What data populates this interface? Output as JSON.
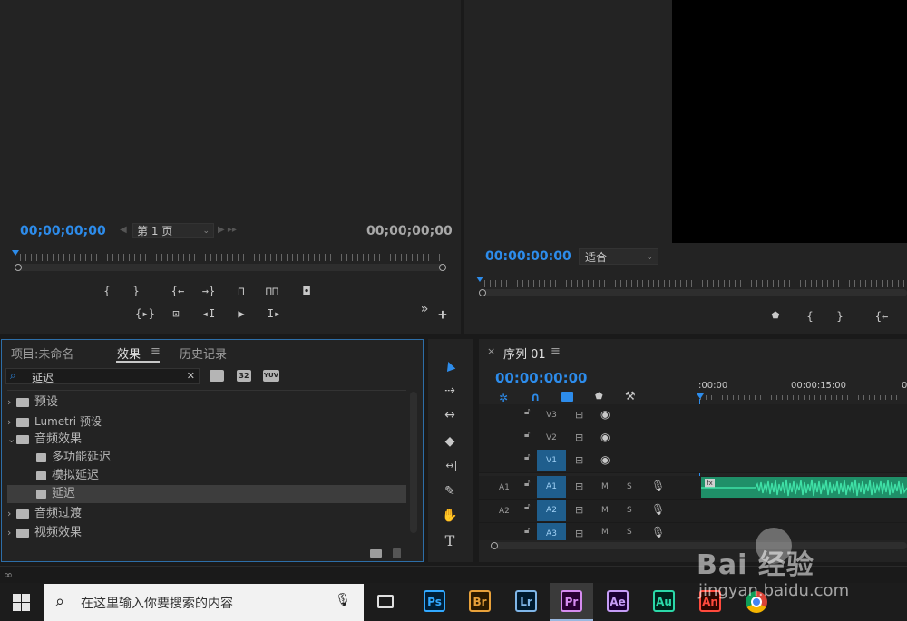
{
  "source_monitor": {
    "timecode_left": "00;00;00;00",
    "page_label": "第 1 页",
    "timecode_right": "00;00;00;00",
    "controls_row1": [
      "{",
      "}",
      "{←",
      "→}",
      "⊓",
      "⊓⊓",
      "◘"
    ],
    "controls_row2": [
      "{▸}",
      "⊡",
      "◂I",
      "▶",
      "I▸"
    ],
    "more": "»",
    "add": "+"
  },
  "program_monitor": {
    "timecode": "00:00:00:00",
    "zoom_value": "适合",
    "controls": [
      "⬟",
      "{",
      "}",
      "{←"
    ]
  },
  "effects_panel": {
    "tabs": [
      "项目:未命名",
      "效果",
      "历史记录"
    ],
    "tab_menu": "≡",
    "search_value": "延迟",
    "clear_icon": "✕",
    "filter_badges": [
      "32",
      "YUV"
    ],
    "tree": [
      {
        "label": "预设",
        "type": "folder",
        "expanded": false,
        "indent": 0
      },
      {
        "label": "Lumetri 预设",
        "type": "folder",
        "expanded": false,
        "indent": 0
      },
      {
        "label": "音频效果",
        "type": "folder",
        "expanded": true,
        "indent": 0
      },
      {
        "label": "多功能延迟",
        "type": "fx",
        "indent": 1
      },
      {
        "label": "模拟延迟",
        "type": "fx",
        "indent": 1
      },
      {
        "label": "延迟",
        "type": "fx",
        "indent": 1,
        "selected": true
      },
      {
        "label": "音频过渡",
        "type": "folder",
        "expanded": false,
        "indent": 0
      },
      {
        "label": "视频效果",
        "type": "folder",
        "expanded": false,
        "indent": 0
      }
    ]
  },
  "timeline": {
    "close": "×",
    "sequence_name": "序列 01",
    "menu": "≡",
    "timecode": "00:00:00:00",
    "ruler_labels": [
      ":00:00",
      "00:00:15:00",
      "0"
    ],
    "video_tracks": [
      "V3",
      "V2",
      "V1"
    ],
    "audio_tracks": [
      {
        "left": "A1",
        "target": "A1"
      },
      {
        "left": "A2",
        "target": "A2"
      },
      {
        "left": "",
        "target": "A3"
      }
    ],
    "mute": "M",
    "solo": "S",
    "clip_badge": "fx",
    "accent_color": "#2d8ceb",
    "audio_clip_color": "#1f8f68"
  },
  "tools": [
    "▲",
    "⇢",
    "↔",
    "◆",
    "|↔|",
    "✎",
    "✋",
    "T"
  ],
  "taskbar": {
    "search_placeholder": "在这里输入你要搜索的内容",
    "apps": [
      {
        "label": "Ps",
        "color": "#31a8ff"
      },
      {
        "label": "Br",
        "color": "#e8a13a"
      },
      {
        "label": "Lr",
        "color": "#7fb6e8"
      },
      {
        "label": "Pr",
        "color": "#d68bf0"
      },
      {
        "label": "Ae",
        "color": "#c59cf6"
      },
      {
        "label": "Au",
        "color": "#2bd8a8"
      },
      {
        "label": "An",
        "color": "#ff4a3d"
      }
    ]
  },
  "watermark": {
    "brand": "Bai 经验",
    "url": "jingyan.baidu.com"
  }
}
